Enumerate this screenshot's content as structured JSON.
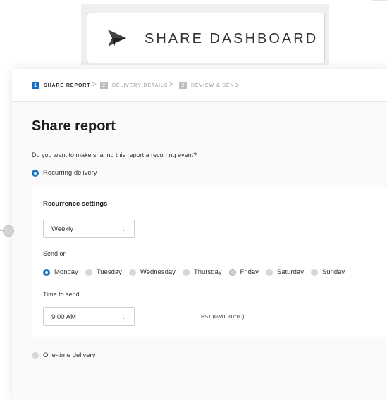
{
  "banner": {
    "button_label": "SHARE DASHBOARD",
    "icon": "paper-plane-icon"
  },
  "steps": [
    {
      "num": "1",
      "label": "SHARE REPORT"
    },
    {
      "num": "2",
      "label": "DELIVERY DETAILS"
    },
    {
      "num": "3",
      "label": "REVIEW & SEND"
    }
  ],
  "step_separator": ">",
  "page": {
    "title": "Share report",
    "question": "Do you want to make sharing this report a recurring event?"
  },
  "options": {
    "recurring": "Recurring delivery",
    "one_time": "One-time delivery"
  },
  "recurrence": {
    "title": "Recurrence settings",
    "frequency": "Weekly",
    "send_on_label": "Send on",
    "days": [
      "Monday",
      "Tuesday",
      "Wednesday",
      "Thursday",
      "Friday",
      "Saturday",
      "Sunday"
    ],
    "selected_day": "Monday",
    "time_label": "Time to send",
    "time": "9:00 AM",
    "timezone": "PST (GMT -07:00)"
  },
  "colors": {
    "accent": "#1a72c7",
    "inactive": "#bdbdbd"
  }
}
